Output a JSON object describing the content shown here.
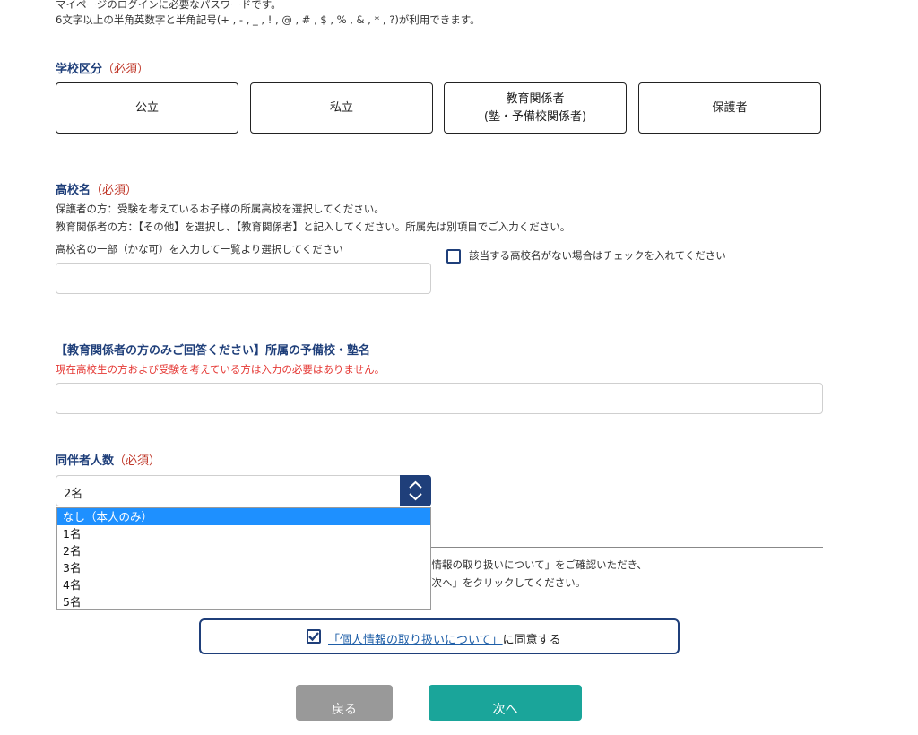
{
  "password_section": {
    "note_line1": "マイページのログインに必要なパスワードです。",
    "note_line2": "6文字以上の半角英数字と半角記号(+ , - , _ , ! , @ , # , $ , % , & , * , ?)が利用できます。"
  },
  "school_category": {
    "label": "学校区分",
    "required": "（必須）",
    "options": [
      {
        "line1": "公立",
        "line2": ""
      },
      {
        "line1": "私立",
        "line2": ""
      },
      {
        "line1": "教育関係者",
        "line2": "(塾・予備校関係者)"
      },
      {
        "line1": "保護者",
        "line2": ""
      }
    ]
  },
  "school_name": {
    "label": "高校名",
    "required": "（必須）",
    "note1": "保護者の方：受験を考えているお子様の所属高校を選択してください。",
    "note2": "教育関係者の方：【その他】を選択し、【教育関係者】と記入してください。所属先は別項目でご入力ください。",
    "input_hint": "高校名の一部（かな可）を入力して一覧より選択してください",
    "input_value": "",
    "no_school_checkbox": "該当する高校名がない場合はチェックを入れてください"
  },
  "prep_school": {
    "label": "【教育関係者の方のみご回答ください】所属の予備校・塾名",
    "warning": "現在高校生の方および受験を考えている方は入力の必要はありません。",
    "input_value": ""
  },
  "companions": {
    "label": "同伴者人数",
    "required": "（必須）",
    "selected": "2名",
    "options": [
      "なし（本人のみ）",
      "1名",
      "2名",
      "3名",
      "4名",
      "5名"
    ],
    "highlighted_index": 0
  },
  "privacy": {
    "text_line1": "人情報の取り扱いについて」をご確認いただき、",
    "text_line2": "「次へ」をクリックしてください。",
    "agree_link": "「個人情報の取り扱いについて」",
    "agree_suffix": "に同意する",
    "agree_checked": true
  },
  "buttons": {
    "back": "戻る",
    "next": "次へ"
  },
  "colors": {
    "accent_navy": "#1f3f7a",
    "required_red": "#c0392b",
    "warning_red": "#e53935",
    "highlight_blue": "#1e90ff",
    "back_gray": "#999999",
    "next_teal": "#1aa59a"
  }
}
